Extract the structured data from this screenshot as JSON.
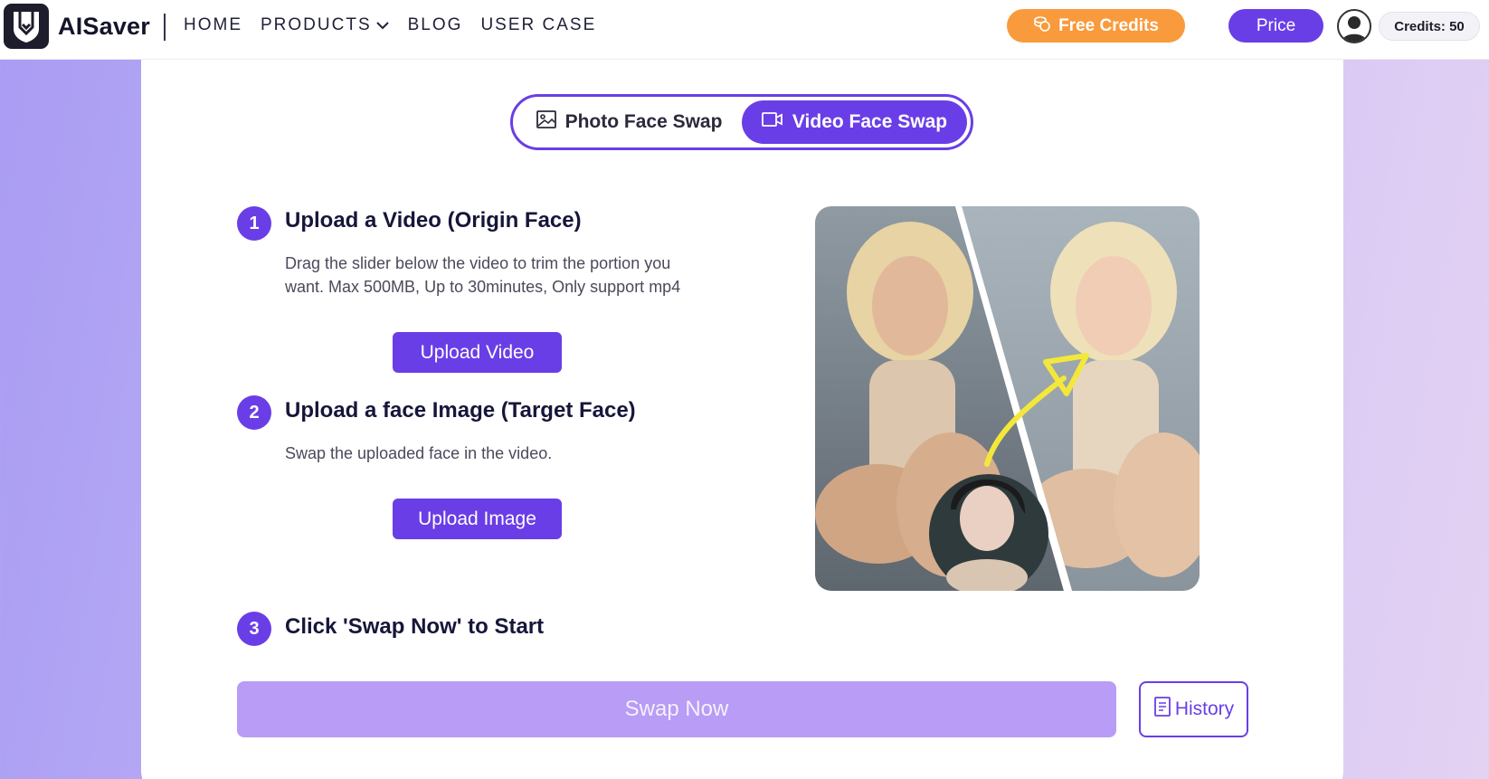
{
  "header": {
    "brand": "AISaver",
    "nav": [
      "HOME",
      "PRODUCTS",
      "BLOG",
      "USER CASE"
    ],
    "free_credits": "Free Credits",
    "price": "Price",
    "credits": "Credits: 50"
  },
  "mode_toggle": {
    "photo": "Photo Face Swap",
    "video": "Video Face Swap",
    "active": "video"
  },
  "steps": [
    {
      "number": "1",
      "title": "Upload a Video (Origin Face)",
      "desc_line1": "Drag the slider below the video to trim the portion you",
      "desc_line2": "want. Max 500MB, Up to 30minutes, Only support mp4",
      "button": "Upload Video"
    },
    {
      "number": "2",
      "title": "Upload a face Image (Target Face)",
      "desc": "Swap the uploaded face in the video.",
      "button": "Upload Image"
    },
    {
      "number": "3",
      "title": "Click 'Swap Now' to Start"
    }
  ],
  "actions": {
    "swap_now": "Swap Now",
    "history": "History"
  },
  "colors": {
    "accent": "#6a3ee6",
    "orange": "#f99a3c",
    "swap_disabled": "#b89cf5"
  },
  "icons": {
    "logo": "download-arrow-shield-icon",
    "products": "chevron-down-icon",
    "free_credits": "coins-icon",
    "photo": "image-icon",
    "video": "video-camera-icon",
    "history": "document-list-icon"
  }
}
